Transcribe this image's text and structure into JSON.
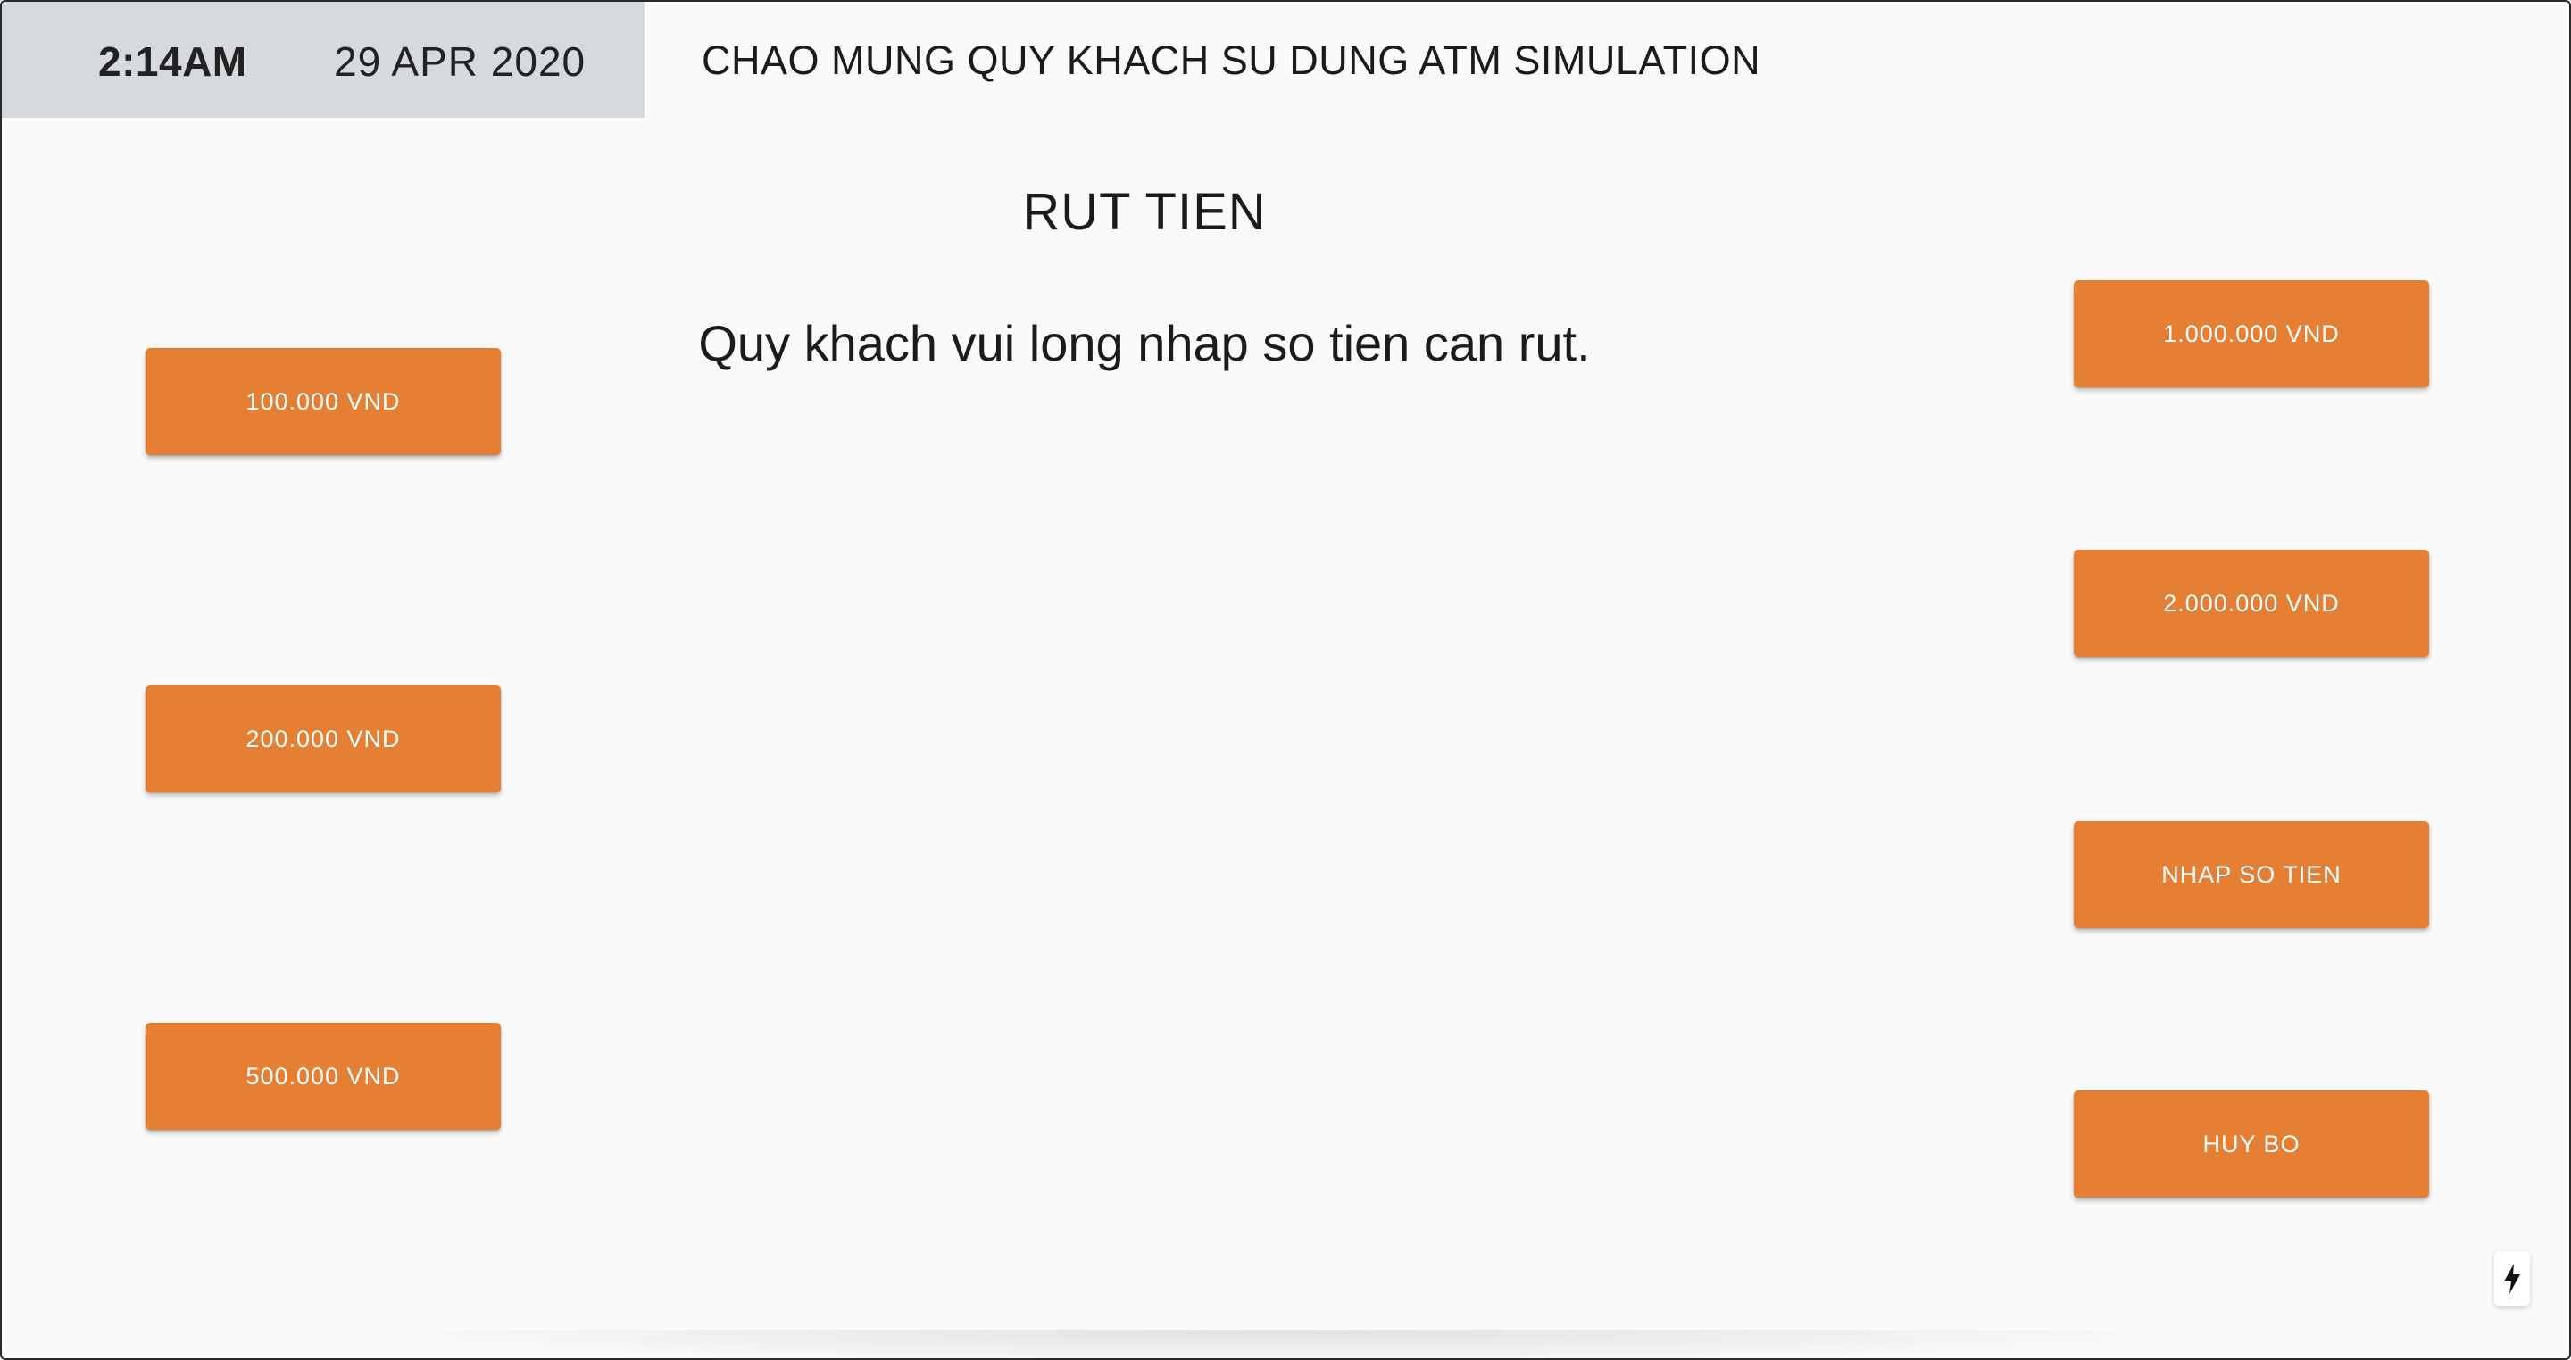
{
  "header": {
    "time": "2:14AM",
    "date": "29 APR 2020",
    "welcome": "CHAO MUNG QUY KHACH SU DUNG ATM SIMULATION"
  },
  "screen": {
    "title": "RUT TIEN",
    "instruction": "Quy khach vui long nhap so tien can rut."
  },
  "left_buttons": [
    {
      "label": "100.000 VND"
    },
    {
      "label": "200.000 VND"
    },
    {
      "label": "500.000 VND"
    }
  ],
  "right_buttons": [
    {
      "label": "1.000.000 VND"
    },
    {
      "label": "2.000.000 VND"
    },
    {
      "label": "NHAP SO TIEN"
    },
    {
      "label": "HUY BO"
    }
  ],
  "colors": {
    "button_bg": "#e47f33",
    "button_text": "#ffffff",
    "clock_bg": "#d6dadf",
    "page_bg": "#fafafa"
  },
  "icons": {
    "fab": "lightning-bolt-icon"
  }
}
